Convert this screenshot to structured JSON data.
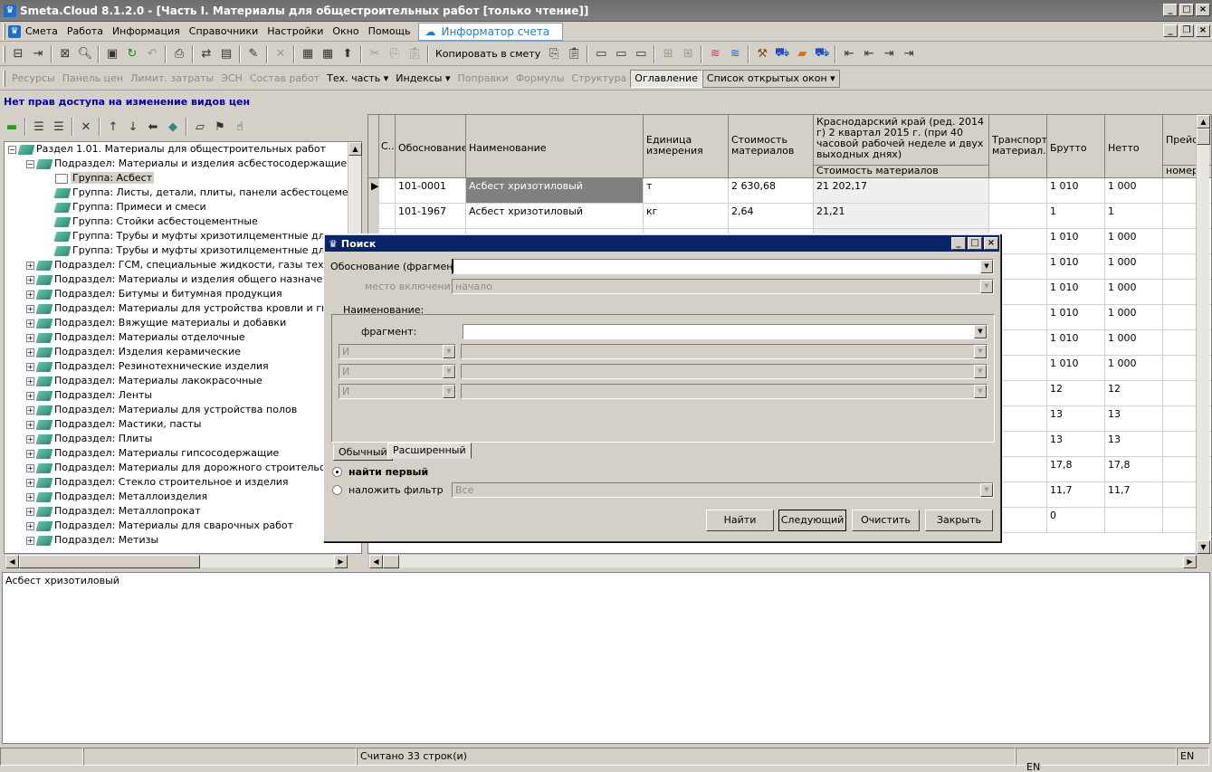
{
  "window": {
    "title": "Smeta.Cloud  8.1.2.0  - [Часть I. Материалы для общестроительных работ  [только чтение]]"
  },
  "menu": [
    "Смета",
    "Работа",
    "Информация",
    "Справочники",
    "Настройки",
    "Окно",
    "Помощь"
  ],
  "informer": "Информатор счета",
  "toolbar2": {
    "copy_label": "Копировать в смету"
  },
  "toolbar3": {
    "items": [
      "Ресурсы",
      "Панель цен",
      "Лимит. затраты",
      "ЭСН",
      "Состав работ",
      "Тех. часть ▾",
      "Индексы ▾",
      "Поправки",
      "Формулы",
      "Структура",
      "Оглавление",
      "Список открытых окон ▾"
    ]
  },
  "notice": "Нет прав доступа на изменение видов цен",
  "tree": [
    {
      "level": 0,
      "label": "Раздел 1.01. Материалы для общестроительных работ",
      "toggle": "−"
    },
    {
      "level": 1,
      "label": "Подраздел: Материалы и изделия асбестосодержащие",
      "toggle": "−"
    },
    {
      "level": 2,
      "label": "Группа: Асбест",
      "selected": true
    },
    {
      "level": 2,
      "label": "Группа: Листы, детали, плиты, панели асбестоцементные"
    },
    {
      "level": 2,
      "label": "Группа: Примеси и смеси"
    },
    {
      "level": 2,
      "label": "Группа: Стойки асбестоцементные"
    },
    {
      "level": 2,
      "label": "Группа: Трубы и муфты хризотилцементные для напо"
    },
    {
      "level": 2,
      "label": "Группа: Трубы и муфты хризотилцементные для безн"
    },
    {
      "level": 1,
      "label": "Подраздел: ГСМ, специальные жидкости, газы техничес",
      "toggle": "+"
    },
    {
      "level": 1,
      "label": "Подраздел: Материалы и изделия общего назначения",
      "toggle": "+"
    },
    {
      "level": 1,
      "label": "Подраздел: Битумы и битумная продукция",
      "toggle": "+"
    },
    {
      "level": 1,
      "label": "Подраздел: Материалы для устройства кровли и гидроиз",
      "toggle": "+"
    },
    {
      "level": 1,
      "label": "Подраздел: Вяжущие материалы и добавки",
      "toggle": "+"
    },
    {
      "level": 1,
      "label": "Подраздел: Материалы отделочные",
      "toggle": "+"
    },
    {
      "level": 1,
      "label": "Подраздел: Изделия керамические",
      "toggle": "+"
    },
    {
      "level": 1,
      "label": "Подраздел: Резинотехнические изделия",
      "toggle": "+"
    },
    {
      "level": 1,
      "label": "Подраздел: Материалы лакокрасочные",
      "toggle": "+"
    },
    {
      "level": 1,
      "label": "Подраздел: Ленты",
      "toggle": "+"
    },
    {
      "level": 1,
      "label": "Подраздел: Материалы для устройства полов",
      "toggle": "+"
    },
    {
      "level": 1,
      "label": "Подраздел: Мастики, пасты",
      "toggle": "+"
    },
    {
      "level": 1,
      "label": "Подраздел: Плиты",
      "toggle": "+"
    },
    {
      "level": 1,
      "label": "Подраздел: Материалы гипсосодержащие",
      "toggle": "+"
    },
    {
      "level": 1,
      "label": "Подраздел: Материалы для дорожного строительства",
      "toggle": "+"
    },
    {
      "level": 1,
      "label": "Подраздел: Стекло строительное и изделия",
      "toggle": "+"
    },
    {
      "level": 1,
      "label": "Подраздел: Металлоизделия",
      "toggle": "+"
    },
    {
      "level": 1,
      "label": "Подраздел: Металлопрокат",
      "toggle": "+"
    },
    {
      "level": 1,
      "label": "Подраздел: Материалы для сварочных работ",
      "toggle": "+"
    },
    {
      "level": 1,
      "label": "Подраздел: Метизы",
      "toggle": "+"
    }
  ],
  "grid": {
    "headers": {
      "c": "С..",
      "code": "Обоснование",
      "name": "Наименование",
      "unit": "Единица измерения",
      "cost": "Стоимость материалов",
      "region": "Краснодарский край (ред. 2014 г) 2 квартал 2015 г. (при 40 часовой рабочей неделе и двух выходных днях)",
      "region_sub": "Стоимость материалов",
      "transport": "Транспорт материал...",
      "brutto": "Брутто",
      "netto": "Нетто",
      "price": "Прейс...",
      "price_sub": "номер"
    },
    "rows": [
      {
        "code": "101-0001",
        "name": "Асбест хризотиловый",
        "unit": "т",
        "cost": "2 630,68",
        "region": "21 202,17",
        "brutto": "1 010",
        "netto": "1 000"
      },
      {
        "code": "101-1967",
        "name": "Асбест хризотиловый",
        "unit": "кг",
        "cost": "2,64",
        "region": "21,21",
        "brutto": "1",
        "netto": "1"
      },
      {
        "brutto": "1 010",
        "netto": "1 000"
      },
      {
        "brutto": "1 010",
        "netto": "1 000"
      },
      {
        "brutto": "1 010",
        "netto": "1 000"
      },
      {
        "brutto": "1 010",
        "netto": "1 000"
      },
      {
        "brutto": "1 010",
        "netto": "1 000"
      },
      {
        "brutto": "1 010",
        "netto": "1 000"
      },
      {
        "brutto": "12",
        "netto": "12"
      },
      {
        "brutto": "13",
        "netto": "13"
      },
      {
        "brutto": "13",
        "netto": "13"
      },
      {
        "brutto": "17,8",
        "netto": "17,8"
      },
      {
        "brutto": "11,7",
        "netto": "11,7"
      },
      {
        "brutto": "0",
        "netto": ""
      }
    ]
  },
  "memo": "Асбест хризотиловый",
  "status": {
    "count": "Считано 33 строк(и)",
    "lang": "EN",
    "lang2": "EN"
  },
  "dialog": {
    "title": "Поиск",
    "code_label": "Обоснование (фрагмент):",
    "code_value": "",
    "place_label": "место включения:",
    "place_value": "начало",
    "name_label": "Наименование:",
    "fragment_label": "фрагмент:",
    "fragment_value": "",
    "op": "И",
    "tabs": [
      "Обычный",
      "Расширенный"
    ],
    "radio_first": "найти первый",
    "radio_filter": "наложить фильтр",
    "filter_value": "Все",
    "buttons": {
      "find": "Найти",
      "next": "Следующий",
      "clear": "Очистить",
      "close": "Закрыть"
    }
  }
}
